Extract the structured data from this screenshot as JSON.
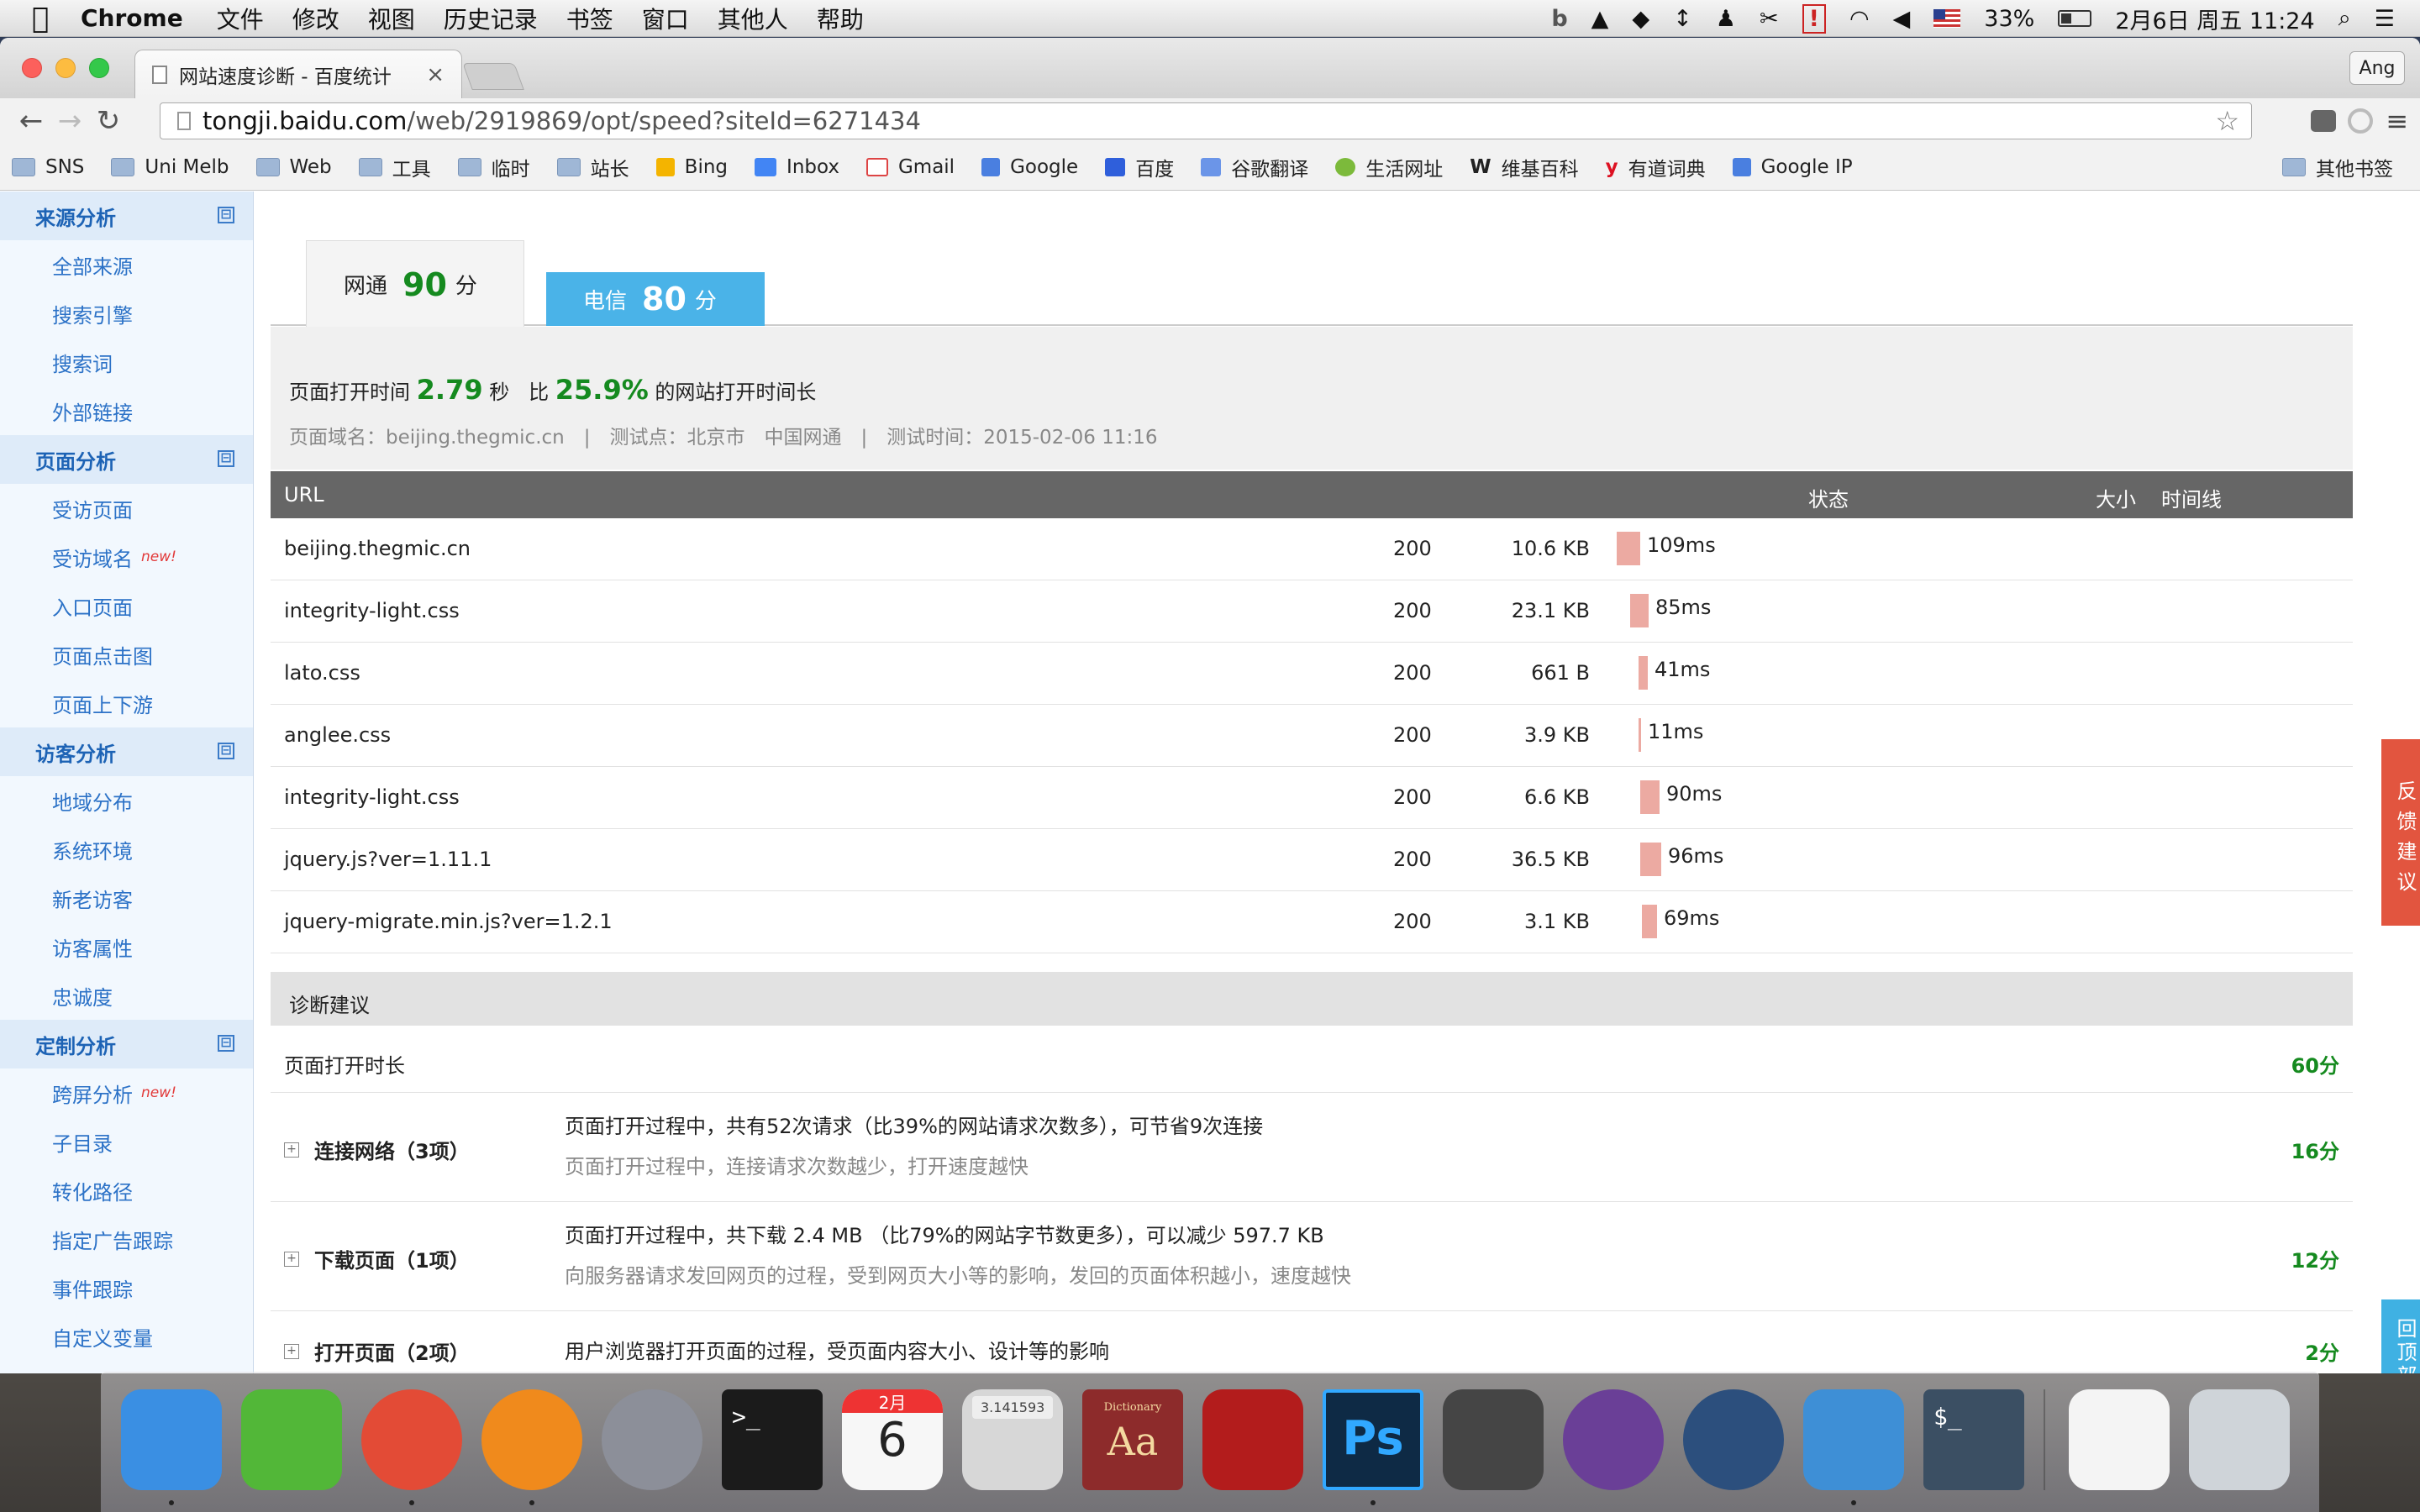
{
  "menubar": {
    "app_name": "Chrome",
    "items": [
      "文件",
      "修改",
      "视图",
      "历史记录",
      "书签",
      "窗口",
      "其他人",
      "帮助"
    ],
    "battery": "33%",
    "datetime": "2月6日 周五 11:24"
  },
  "browser": {
    "tab_title": "网站速度诊断 - 百度统计",
    "profile": "Ang",
    "url_host": "tongji.baidu.com",
    "url_path": "/web/2919869/opt/speed?siteId=6271434",
    "bookmarks": [
      "SNS",
      "Uni Melb",
      "Web",
      "工具",
      "临时",
      "站长",
      "Bing",
      "Inbox",
      "Gmail",
      "Google",
      "百度",
      "谷歌翻译",
      "生活网址",
      "维基百科",
      "有道词典",
      "Google IP"
    ],
    "other_bookmarks": "其他书签"
  },
  "sidebar": {
    "sections": [
      {
        "title": "来源分析",
        "items": [
          {
            "label": "全部来源"
          },
          {
            "label": "搜索引擎"
          },
          {
            "label": "搜索词"
          },
          {
            "label": "外部链接"
          }
        ]
      },
      {
        "title": "页面分析",
        "items": [
          {
            "label": "受访页面"
          },
          {
            "label": "受访域名",
            "badge": "new!"
          },
          {
            "label": "入口页面"
          },
          {
            "label": "页面点击图"
          },
          {
            "label": "页面上下游"
          }
        ]
      },
      {
        "title": "访客分析",
        "items": [
          {
            "label": "地域分布"
          },
          {
            "label": "系统环境"
          },
          {
            "label": "新老访客"
          },
          {
            "label": "访客属性"
          },
          {
            "label": "忠诚度"
          }
        ]
      },
      {
        "title": "定制分析",
        "items": [
          {
            "label": "跨屏分析",
            "badge": "new!"
          },
          {
            "label": "子目录"
          },
          {
            "label": "转化路径"
          },
          {
            "label": "指定广告跟踪"
          },
          {
            "label": "事件跟踪"
          },
          {
            "label": "自定义变量"
          }
        ]
      }
    ],
    "toggle": "⊟"
  },
  "score_tabs": [
    {
      "name": "网通",
      "score": "90",
      "unit": "分"
    },
    {
      "name": "电信",
      "score": "80",
      "unit": "分"
    }
  ],
  "summary": {
    "open_time_label": "页面打开时间",
    "open_time": "2.79",
    "sec": "秒",
    "compare_prefix": "比",
    "compare_pct": "25.9%",
    "compare_suffix": "的网站打开时间长",
    "detail": "页面域名：beijing.thegmic.cn　|　测试点：北京市　中国网通　|　测试时间：2015-02-06 11:16"
  },
  "table": {
    "headers": {
      "url": "URL",
      "status": "状态",
      "size": "大小",
      "timeline": "时间线"
    },
    "rows": [
      {
        "url": "beijing.thegmic.cn",
        "status": "200",
        "size": "10.6 KB",
        "time": "109ms",
        "ms": 109,
        "offset": 0
      },
      {
        "url": "integrity-light.css",
        "status": "200",
        "size": "23.1 KB",
        "time": "85ms",
        "ms": 85,
        "offset": 16
      },
      {
        "url": "lato.css",
        "status": "200",
        "size": "661 B",
        "time": "41ms",
        "ms": 41,
        "offset": 26
      },
      {
        "url": "anglee.css",
        "status": "200",
        "size": "3.9 KB",
        "time": "11ms",
        "ms": 11,
        "offset": 26
      },
      {
        "url": "integrity-light.css",
        "status": "200",
        "size": "6.6 KB",
        "time": "90ms",
        "ms": 90,
        "offset": 28
      },
      {
        "url": "jquery.js?ver=1.11.1",
        "status": "200",
        "size": "36.5 KB",
        "time": "96ms",
        "ms": 96,
        "offset": 28
      },
      {
        "url": "jquery-migrate.min.js?ver=1.2.1",
        "status": "200",
        "size": "3.1 KB",
        "time": "69ms",
        "ms": 69,
        "offset": 30
      }
    ]
  },
  "diagnosis": {
    "title": "诊断建议",
    "open_time": {
      "label": "页面打开时长",
      "score": "60分"
    },
    "items": [
      {
        "label": "连接网络（3项）",
        "d1": "页面打开过程中，共有52次请求（比39%的网站请求次数多），可节省9次连接",
        "d2": "页面打开过程中，连接请求次数越少，打开速度越快",
        "score": "16分"
      },
      {
        "label": "下载页面（1项）",
        "d1": "页面打开过程中，共下载 2.4 MB （比79%的网站字节数更多），可以减少 597.7 KB",
        "d2": "向服务器请求发回网页的过程，受到网页大小等的影响，发回的页面体积越小，速度越快",
        "score": "12分"
      },
      {
        "label": "打开页面（2项）",
        "d1": "用户浏览器打开页面的过程，受页面内容大小、设计等的影响",
        "d2": "",
        "score": "2分"
      }
    ]
  },
  "float": {
    "feedback": "反馈建议",
    "backtop": "回顶部"
  },
  "dock": {
    "calendar_month": "2月",
    "calendar_day": "6",
    "calculator_display": "3.141593",
    "dictionary_label": "Dictionary",
    "dictionary_glyph": "Aa",
    "photoshop_label": "Ps",
    "terminal_prompt": ">_",
    "terminal2_prompt": "$_",
    "apps": [
      {
        "name": "Finder",
        "color": "#3a8fe3"
      },
      {
        "name": "WeChat",
        "color": "#52b738"
      },
      {
        "name": "Chrome",
        "color": "#e34b36"
      },
      {
        "name": "Firefox",
        "color": "#f08a1c"
      },
      {
        "name": "Launchpad",
        "color": "#8c8f99"
      },
      {
        "name": "Terminal",
        "color": "#1b1b1b"
      },
      {
        "name": "Calendar",
        "color": "#f7f7f7"
      },
      {
        "name": "Calculator",
        "color": "#d7d7d7"
      },
      {
        "name": "Dictionary",
        "color": "#8d2b2b"
      },
      {
        "name": "FileZilla",
        "color": "#b31c1c"
      },
      {
        "name": "Photoshop",
        "color": "#0e2a45"
      },
      {
        "name": "Sublime Text",
        "color": "#454545"
      },
      {
        "name": "GitHub",
        "color": "#6a3f97"
      },
      {
        "name": "SourceTree",
        "color": "#2c4f7d"
      },
      {
        "name": "Xee",
        "color": "#3e8fd6"
      },
      {
        "name": "Terminal 2",
        "color": "#3b4f63"
      },
      {
        "name": "Document",
        "color": "#f4f4f4"
      },
      {
        "name": "Trash",
        "color": "#cfd4d9"
      }
    ]
  }
}
